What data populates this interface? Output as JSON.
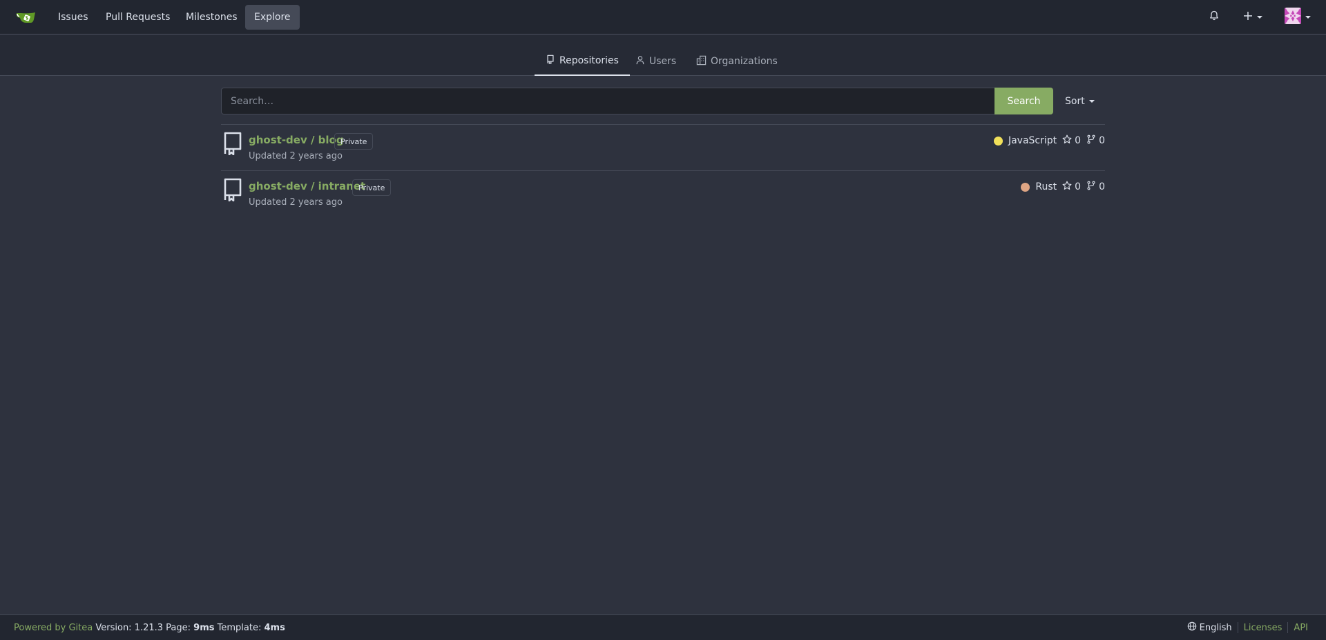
{
  "nav": {
    "logo_icon": "gitea-logo-icon",
    "items": [
      {
        "label": "Issues"
      },
      {
        "label": "Pull Requests"
      },
      {
        "label": "Milestones"
      },
      {
        "label": "Explore"
      }
    ],
    "notification_icon": "bell-icon",
    "create_icon": "plus-icon",
    "avatar_icon": "user-avatar"
  },
  "tabs": [
    {
      "label": "Repositories",
      "icon": "repo-icon"
    },
    {
      "label": "Users",
      "icon": "person-icon"
    },
    {
      "label": "Organizations",
      "icon": "organization-icon"
    }
  ],
  "search": {
    "placeholder": "Search…",
    "value": "",
    "button_label": "Search",
    "sort_label": "Sort"
  },
  "repos": [
    {
      "name": "ghost-dev / blog",
      "visibility": "Private",
      "updated": "Updated 2 years ago",
      "language": "JavaScript",
      "language_color": "#f1e05a",
      "stars": "0",
      "forks": "0"
    },
    {
      "name": "ghost-dev / intranet",
      "visibility": "Private",
      "updated": "Updated 2 years ago",
      "language": "Rust",
      "language_color": "#dea584",
      "stars": "0",
      "forks": "0"
    }
  ],
  "footer": {
    "powered_by": "Powered by Gitea",
    "version_text": "Version: 1.21.3 Page:",
    "page_time": "9ms",
    "template_label": "Template:",
    "template_time": "4ms",
    "language": "English",
    "licenses": "Licenses",
    "api": "API"
  },
  "colors": {
    "accent": "#87ab63",
    "background": "#2e323e",
    "navbar": "#222630"
  }
}
